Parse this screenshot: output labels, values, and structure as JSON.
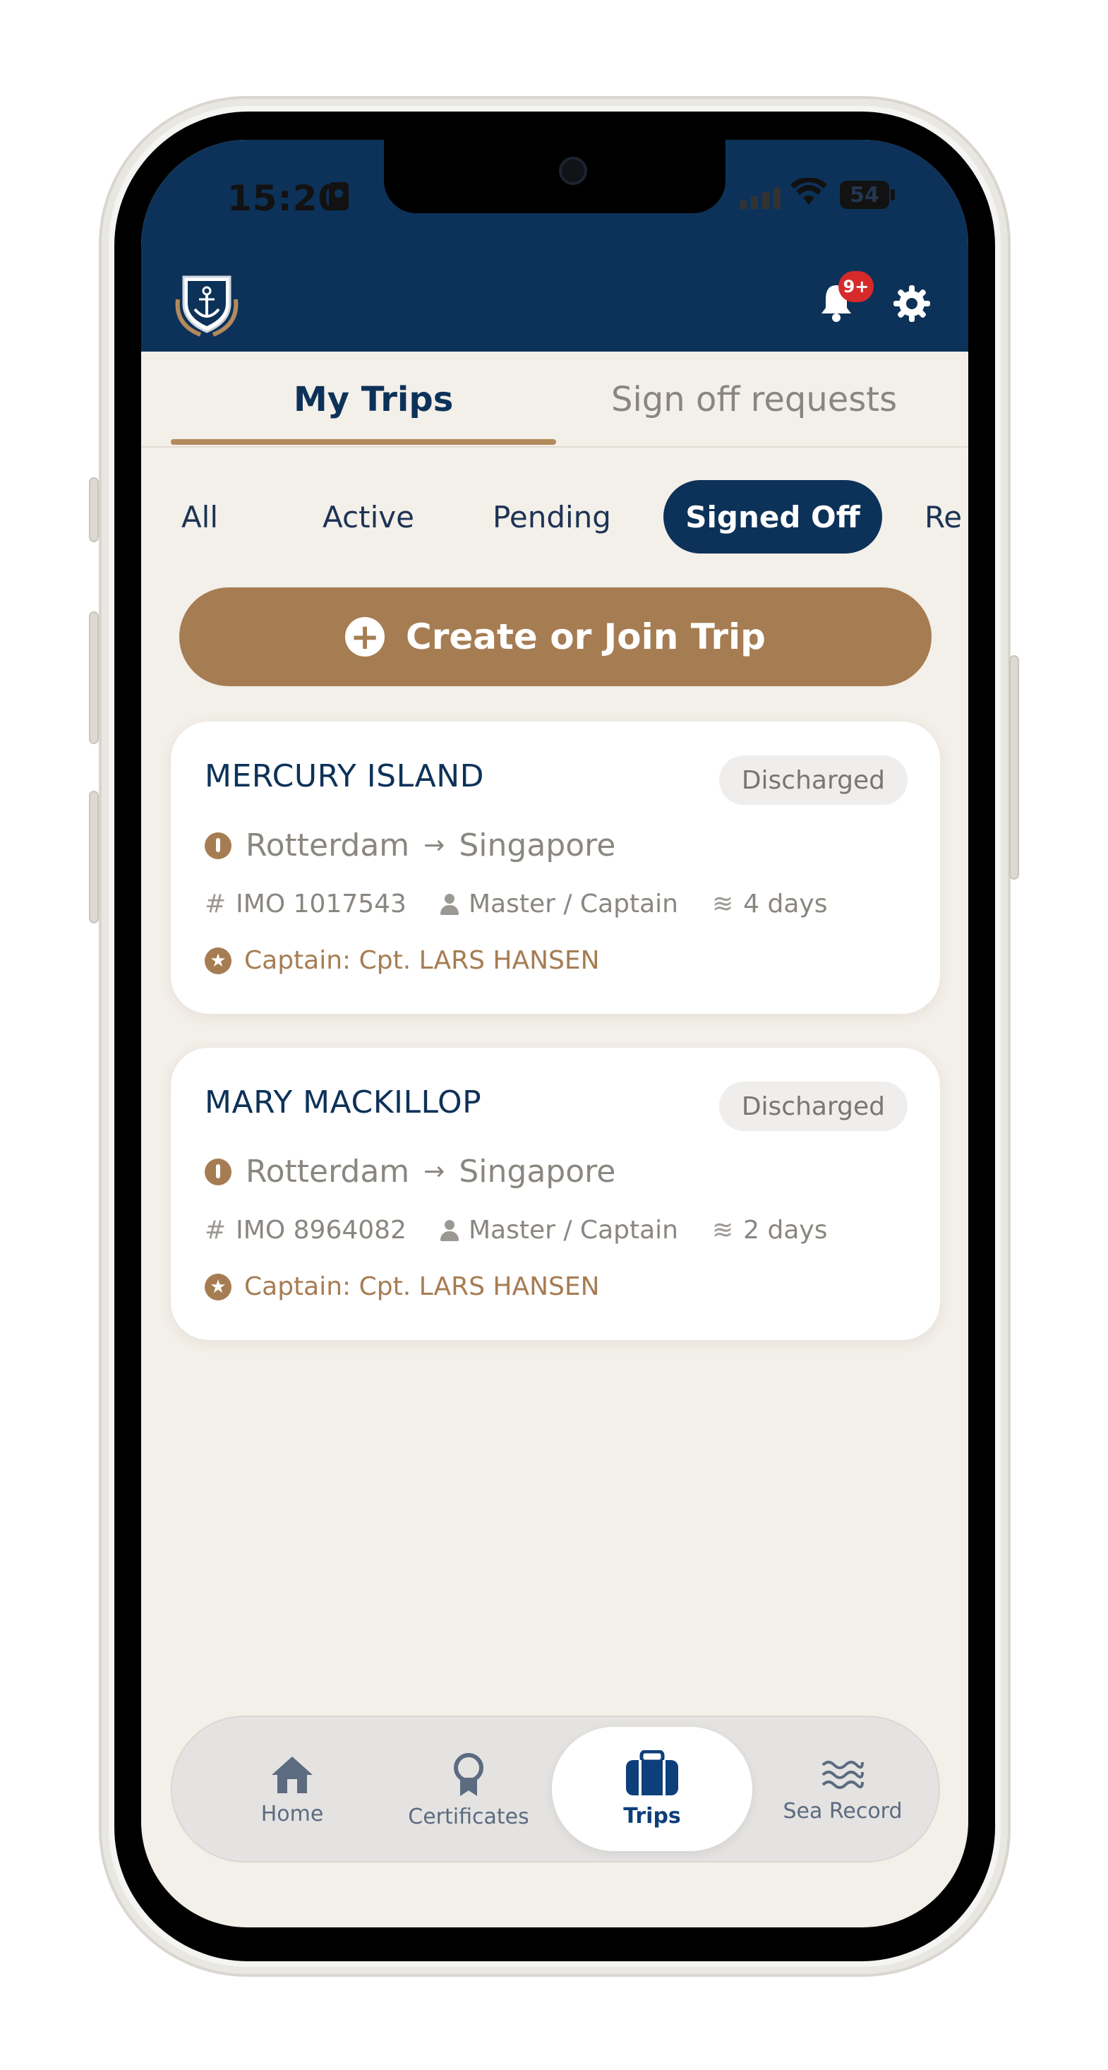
{
  "status_bar": {
    "time": "15:20",
    "battery": "54"
  },
  "header": {
    "notification_count": "9+"
  },
  "tabs": [
    {
      "label": "My Trips"
    },
    {
      "label": "Sign off requests"
    }
  ],
  "filters": [
    {
      "label": "All"
    },
    {
      "label": "Active"
    },
    {
      "label": "Pending"
    },
    {
      "label": "Signed Off"
    },
    {
      "label": "Re"
    }
  ],
  "cta": {
    "label": "Create or Join Trip"
  },
  "trips": [
    {
      "vessel": "MERCURY ISLAND",
      "status": "Discharged",
      "from": "Rotterdam",
      "to": "Singapore",
      "imo": "IMO 1017543",
      "role": "Master / Captain",
      "duration": "4 days",
      "captain": "Captain: Cpt. LARS HANSEN"
    },
    {
      "vessel": "MARY MACKILLOP",
      "status": "Discharged",
      "from": "Rotterdam",
      "to": "Singapore",
      "imo": "IMO 8964082",
      "role": "Master / Captain",
      "duration": "2 days",
      "captain": "Captain: Cpt. LARS HANSEN"
    }
  ],
  "bottom_nav": [
    {
      "label": "Home",
      "icon": "home-icon"
    },
    {
      "label": "Certificates",
      "icon": "award-icon"
    },
    {
      "label": "Trips",
      "icon": "briefcase-icon"
    },
    {
      "label": "Sea Record",
      "icon": "waves-icon"
    }
  ],
  "colors": {
    "primary": "#0d3259",
    "accent": "#a67c52",
    "background": "#f3efe9",
    "badge_red": "#d62a2a"
  }
}
